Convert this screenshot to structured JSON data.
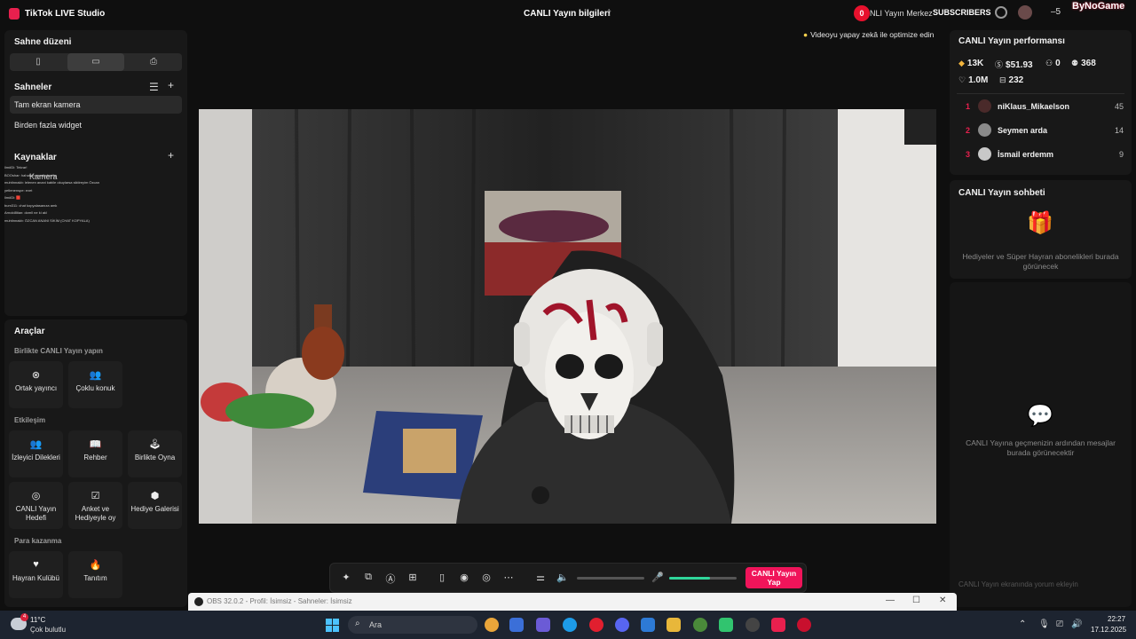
{
  "titlebar": {
    "app_name": "TikTok LIVE Studio",
    "center_title": "CANLI Yayın bilgileri",
    "share_icon": "share-icon",
    "notif_count": "0",
    "live_center_label": "NLI Yayın Merkez",
    "subscribers_label": "SUBSCRIBERS",
    "minimize_label": "–5",
    "brand": "ByNoGame"
  },
  "left": {
    "layout_title": "Sahne düzeni",
    "orientations": [
      "▯",
      "▭",
      "⎙"
    ],
    "scenes_title": "Sahneler",
    "scenes": [
      "Tam ekran kamera",
      "Birden fazla widget"
    ],
    "sources_title": "Kaynaklar",
    "source_camera": "Kamera",
    "chat_overlay": [
      "lim#Di: Tekrar!",
      "BOOshar: hahahaha sodjwkedfw",
      "muhtinnakb: lelenen anani kabile okuylarsa siktireyim Özcan",
      "yetlenenspe: evet",
      "lim#Di: 🟥",
      "bum311: chat kopyalasanıza amk",
      "Arnold8tian: domll ne ki akl",
      "muhtinnakb: ÖZCAN ANANI SİKİM (CHAT KOPYALA)"
    ],
    "tools_title": "Araçlar",
    "together_title": "Birlikte CANLI Yayın yapın",
    "together_tools": [
      {
        "icon": "⊗",
        "label": "Ortak yayıncı"
      },
      {
        "icon": "👥",
        "label": "Çoklu konuk"
      }
    ],
    "engagement_title": "Etkileşim",
    "engagement_tools": [
      {
        "icon": "👥",
        "label": "İzleyici Dilekleri"
      },
      {
        "icon": "📖",
        "label": "Rehber"
      },
      {
        "icon": "🕹",
        "label": "Birlikte Oyna"
      },
      {
        "icon": "◎",
        "label": "CANLI Yayın Hedefi"
      },
      {
        "icon": "☑",
        "label": "Anket ve Hediyeyle oy"
      },
      {
        "icon": "⬢",
        "label": "Hediye Galerisi"
      }
    ],
    "monetize_title": "Para kazanma",
    "monetize_tools": [
      {
        "icon": "♥",
        "label": "Hayran Kulübü"
      },
      {
        "icon": "🔥",
        "label": "Tanıtım"
      }
    ]
  },
  "center": {
    "ai_hint": "Videoyu yapay zekâ ile optimize edin",
    "go_live": "CANLI Yayın Yap",
    "mic_level": 0.6
  },
  "right": {
    "perf_title": "CANLI Yayın performansı",
    "stats": {
      "diamonds": "13K",
      "earnings": "$51.93",
      "followers": "0",
      "viewers": "368",
      "likes": "1.0M",
      "gifts": "232"
    },
    "ranking": [
      {
        "rank": "1",
        "name": "niKlaus_Mikaelson",
        "value": "45"
      },
      {
        "rank": "2",
        "name": "Seymen arda",
        "value": "14"
      },
      {
        "rank": "3",
        "name": "İsmail erdemm",
        "value": "9"
      }
    ],
    "chat_title": "CANLI Yayın sohbeti",
    "gifts_empty": "Hediyeler ve Süper Hayran abonelikleri burada görünecek",
    "chat_empty": "CANLI Yayına geçmenizin ardından mesajlar burada görünecektir",
    "chat_input_placeholder": "CANLI Yayın ekranında yorum ekleyin"
  },
  "obs": {
    "title": "OBS 32.0.2 - Profil: İsimsiz - Sahneler: İsimsiz"
  },
  "taskbar": {
    "weather_badge": "4",
    "temperature": "11°C",
    "weather_desc": "Çok bulutlu",
    "search_placeholder": "Ara",
    "time": "22:27",
    "date": "17.12.2025"
  }
}
